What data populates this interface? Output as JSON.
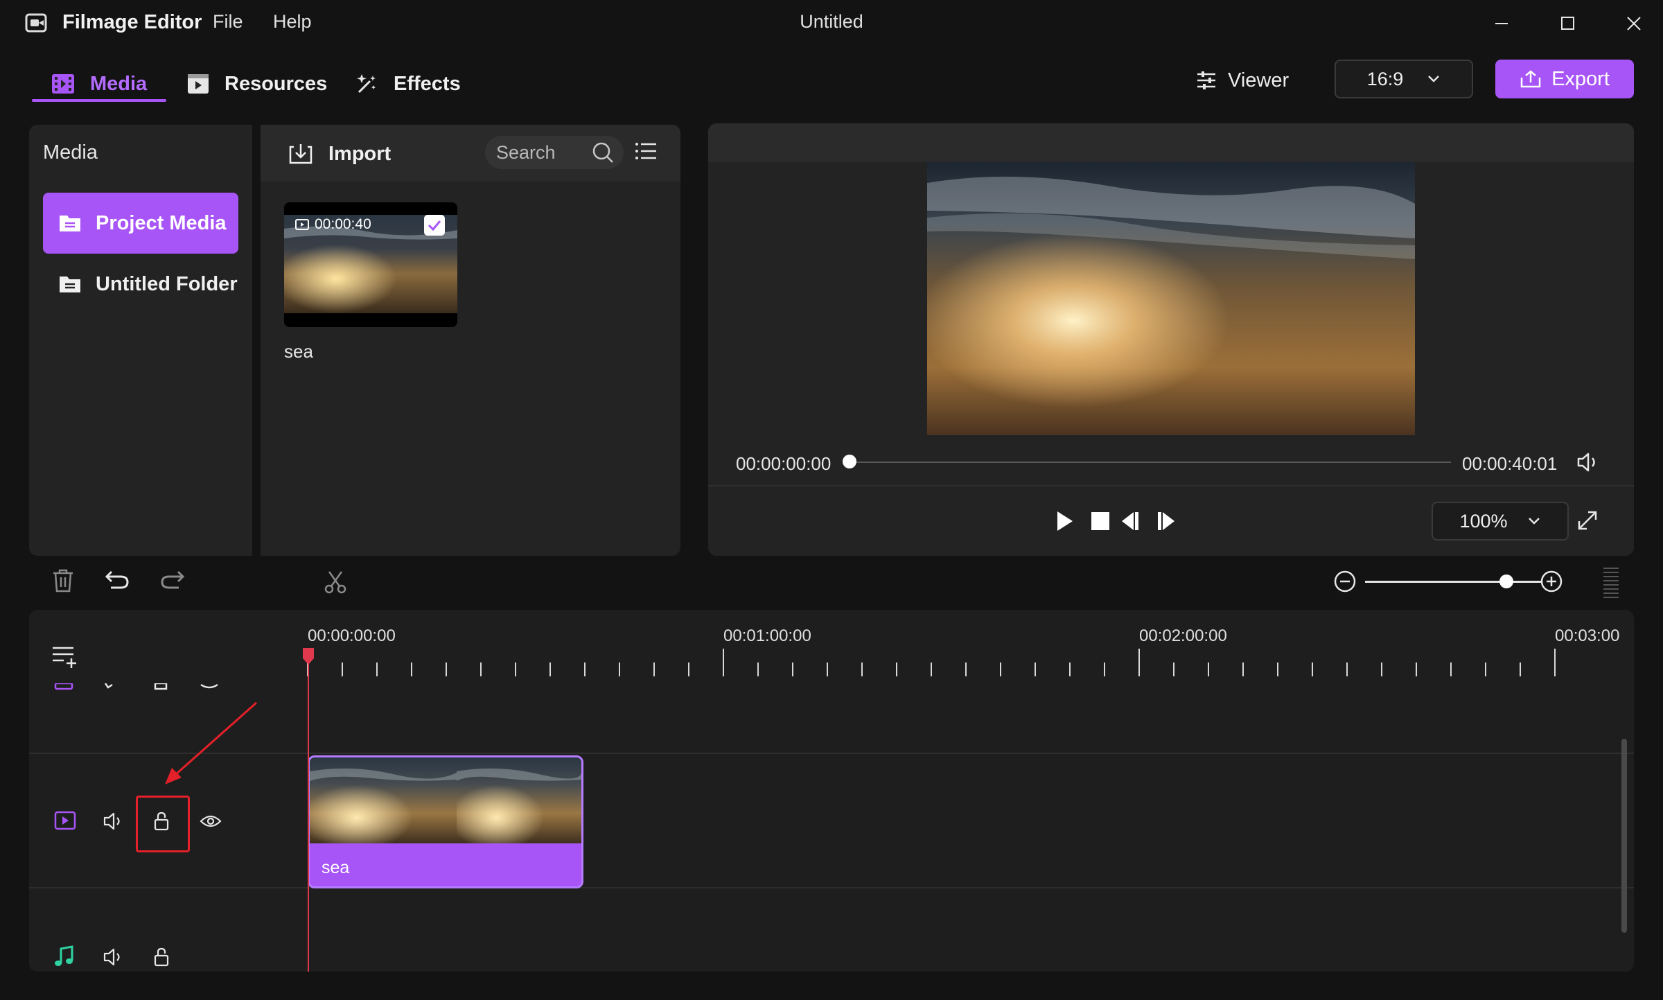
{
  "titlebar": {
    "app_name": "Filmage Editor",
    "menu": [
      "File",
      "Help"
    ],
    "window_title": "Untitled"
  },
  "tabs": [
    {
      "label": "Media",
      "active": true
    },
    {
      "label": "Resources",
      "active": false
    },
    {
      "label": "Effects",
      "active": false
    }
  ],
  "topbar": {
    "viewer_label": "Viewer",
    "aspect_ratio": "16:9",
    "export_label": "Export"
  },
  "sidebar": {
    "title": "Media",
    "items": [
      {
        "label": "Project Media",
        "active": true
      },
      {
        "label": "Untitled Folder",
        "active": false
      }
    ]
  },
  "media_panel": {
    "import_label": "Import",
    "search_placeholder": "Search",
    "items": [
      {
        "name": "sea",
        "duration": "00:00:40",
        "selected": true
      }
    ]
  },
  "viewer": {
    "current_time": "00:00:00:00",
    "total_time": "00:00:40:01",
    "progress": 0,
    "zoom": "100%"
  },
  "timeline": {
    "ruler_labels": [
      "00:00:00:00",
      "00:01:00:00",
      "00:02:00:00",
      "00:03:00"
    ],
    "zoom_level": 0.45,
    "clips": [
      {
        "name": "sea",
        "track": "video"
      }
    ]
  },
  "colors": {
    "accent": "#a855f7",
    "playhead": "#e0394d",
    "highlight_box": "#e5202a",
    "audio_icon": "#2fd3a1"
  }
}
